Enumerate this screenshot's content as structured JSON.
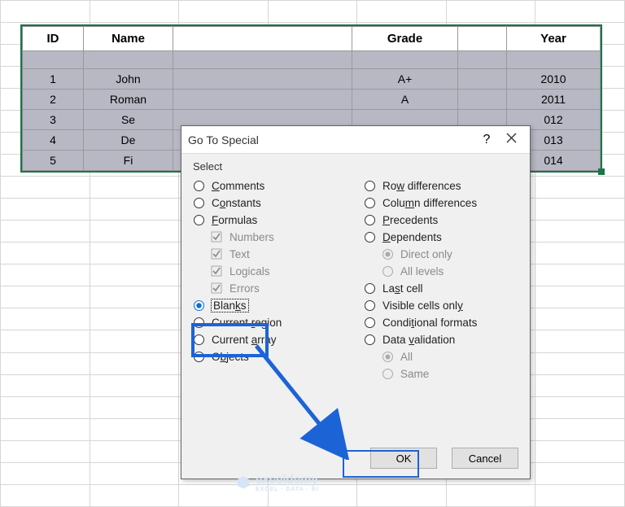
{
  "spreadsheet": {
    "headers": [
      "ID",
      "Name",
      "",
      "Grade",
      "",
      "Year"
    ],
    "rows": [
      {
        "id": "1",
        "name": "John",
        "grade": "A+",
        "year": "2010"
      },
      {
        "id": "2",
        "name": "Roman",
        "grade": "A",
        "year": "2011"
      },
      {
        "id": "3",
        "name": "Se",
        "grade": "",
        "year": "012"
      },
      {
        "id": "4",
        "name": "De",
        "grade": "",
        "year": "013"
      },
      {
        "id": "5",
        "name": "Fi",
        "grade": "",
        "year": "014"
      }
    ]
  },
  "dialog": {
    "title": "Go To Special",
    "help": "?",
    "close": "×",
    "section": "Select",
    "options_left": {
      "comments": "Comments",
      "constants": "Constants",
      "formulas": "Formulas",
      "numbers": "Numbers",
      "text": "Text",
      "logicals": "Logicals",
      "errors": "Errors",
      "blanks": "Blanks",
      "current_region": "Current region",
      "current_array": "Current array",
      "objects": "Objects"
    },
    "options_right": {
      "row_diff": "Row differences",
      "col_diff": "Column differences",
      "precedents": "Precedents",
      "dependents": "Dependents",
      "direct_only": "Direct only",
      "all_levels": "All levels",
      "last_cell": "Last cell",
      "visible_only": "Visible cells only",
      "cond_formats": "Conditional formats",
      "data_validation": "Data validation",
      "all": "All",
      "same": "Same"
    },
    "ok": "OK",
    "cancel": "Cancel"
  },
  "watermark": {
    "brand": "exceldemy",
    "tagline": "EXCEL · DATA · BI"
  }
}
